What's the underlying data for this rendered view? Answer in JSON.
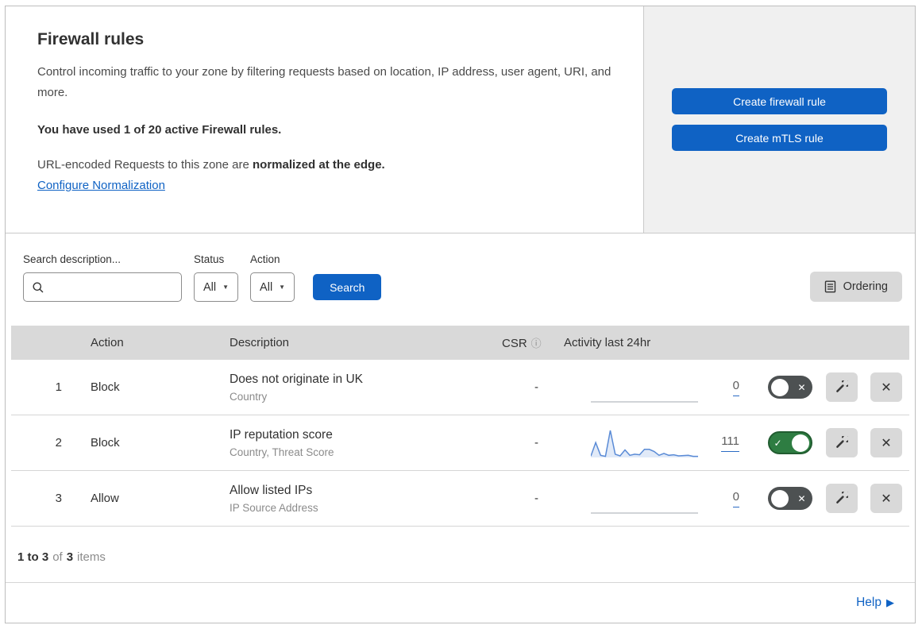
{
  "colors": {
    "accent": "#0f62c4",
    "panel_gray": "#f0f0f0",
    "header_band": "#d9d9d9",
    "toggle_on": "#2e7d42",
    "toggle_off": "#4d5152",
    "sparkline": "#5a8bd6",
    "sparkline_fill": "rgba(90,139,214,0.18)",
    "sparkline_empty": "#c2c6cb"
  },
  "icons": {
    "search_icon": "magnifying-glass",
    "ordering_icon": "document-lines",
    "edit_icon": "wrench",
    "info_glyph": "ⓘ",
    "caret_glyph": "▼",
    "check_glyph": "✓",
    "x_glyph": "✕",
    "help_arrow_glyph": "▶"
  },
  "intro": {
    "title": "Firewall rules",
    "description": "Control incoming traffic to your zone by filtering requests based on location, IP address, user agent, URI, and more.",
    "usage": "You have used 1 of 20 active Firewall rules.",
    "normalization_prefix": "URL-encoded Requests to this zone are ",
    "normalization_bold": "normalized at the edge.",
    "normalization_link": "Configure Normalization"
  },
  "actions_panel": {
    "create_firewall_label": "Create firewall rule",
    "create_mtls_label": "Create mTLS rule"
  },
  "filters": {
    "search_label": "Search description...",
    "search_value": "",
    "status_label": "Status",
    "status_value": "All",
    "action_label": "Action",
    "action_value": "All",
    "search_button_label": "Search",
    "ordering_button_label": "Ordering"
  },
  "table": {
    "headers": {
      "action": "Action",
      "description": "Description",
      "csr": "CSR",
      "activity": "Activity last 24hr"
    },
    "rows": [
      {
        "priority": "1",
        "action": "Block",
        "description": "Does not originate in UK",
        "criteria": "Country",
        "csr": "-",
        "activity_count": "0",
        "enabled": false,
        "sparkline": []
      },
      {
        "priority": "2",
        "action": "Block",
        "description": "IP reputation score",
        "criteria": "Country, Threat Score",
        "csr": "-",
        "activity_count": "111",
        "enabled": true,
        "sparkline": [
          5,
          55,
          8,
          4,
          100,
          12,
          6,
          28,
          8,
          12,
          10,
          30,
          30,
          22,
          8,
          15,
          8,
          10,
          6,
          7,
          8,
          4,
          4
        ]
      },
      {
        "priority": "3",
        "action": "Allow",
        "description": "Allow listed IPs",
        "criteria": "IP Source Address",
        "csr": "-",
        "activity_count": "0",
        "enabled": false,
        "sparkline": []
      }
    ]
  },
  "footer": {
    "range": "1 to 3",
    "of_text": "of",
    "total": "3",
    "items_text": "items",
    "help_label": "Help"
  }
}
